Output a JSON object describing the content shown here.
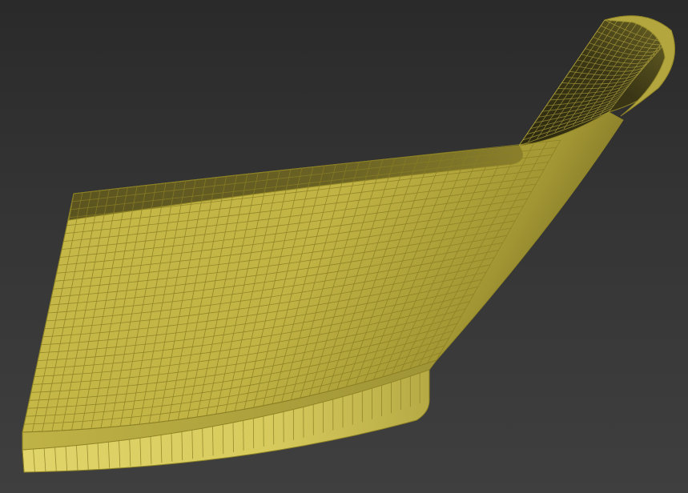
{
  "viewport": {
    "background_top": "#2a2a2a",
    "background_bottom": "#3f3f3f"
  },
  "mesh": {
    "object": "swept-blade-surface",
    "display": "wireframe-on-shaded",
    "fill_color": "#c8b94a",
    "shadow_color": "#4a4418",
    "highlight_color": "#e2d76a",
    "wire_color": "#8f8426"
  }
}
